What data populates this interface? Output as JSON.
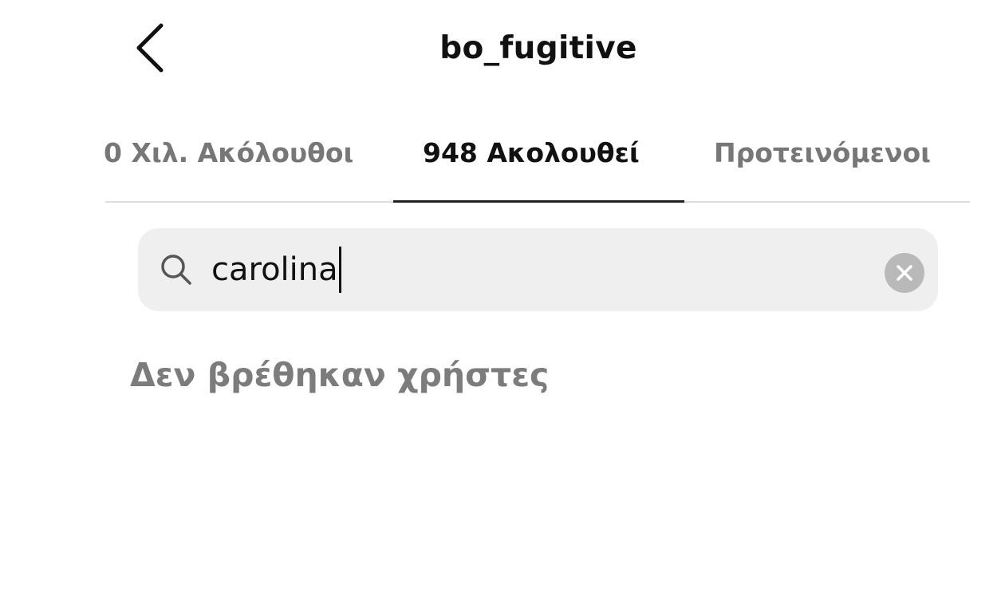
{
  "header": {
    "title": "bo_fugitive",
    "back_icon": "chevron-left-icon"
  },
  "tabs": [
    {
      "label": "0 Χιλ. Ακόλουθοι",
      "active": false
    },
    {
      "label": "948 Ακολουθεί",
      "active": true
    },
    {
      "label": "Προτεινόμενοι",
      "active": false
    }
  ],
  "search": {
    "value": "carolina",
    "icon": "search-icon",
    "clear_icon": "clear-icon"
  },
  "results": {
    "empty_message": "Δεν βρέθηκαν χρήστες"
  },
  "colors": {
    "active_tab": "#111111",
    "inactive_tab": "#777777",
    "search_background": "#efefef",
    "muted_text": "#7c7c7c"
  }
}
